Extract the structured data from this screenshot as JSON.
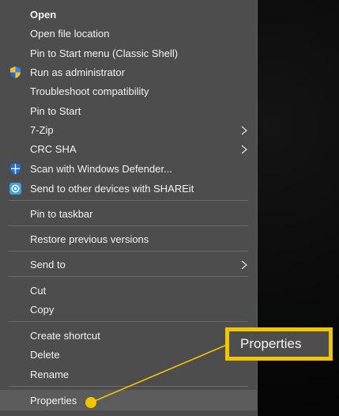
{
  "menu": {
    "items": [
      {
        "label": "Open",
        "bold": true
      },
      {
        "label": "Open file location"
      },
      {
        "label": "Pin to Start menu (Classic Shell)"
      },
      {
        "label": "Run as administrator",
        "icon": "uac-shield-icon"
      },
      {
        "label": "Troubleshoot compatibility"
      },
      {
        "label": "Pin to Start"
      },
      {
        "label": "7-Zip",
        "submenu": true
      },
      {
        "label": "CRC SHA",
        "submenu": true
      },
      {
        "label": "Scan with Windows Defender...",
        "icon": "windows-defender-icon"
      },
      {
        "label": "Send to other devices with SHAREit",
        "icon": "shareit-icon"
      },
      {
        "label": "Pin to taskbar"
      },
      {
        "label": "Restore previous versions"
      },
      {
        "label": "Send to",
        "submenu": true
      },
      {
        "label": "Cut"
      },
      {
        "label": "Copy"
      },
      {
        "label": "Create shortcut"
      },
      {
        "label": "Delete"
      },
      {
        "label": "Rename"
      },
      {
        "label": "Properties",
        "highlighted": true
      }
    ]
  },
  "callout": {
    "label": "Properties",
    "border_color": "#f3c400"
  },
  "colors": {
    "menu_bg": "#4d4d4d",
    "text": "#f2f2f2",
    "highlight": "#f3c400"
  }
}
